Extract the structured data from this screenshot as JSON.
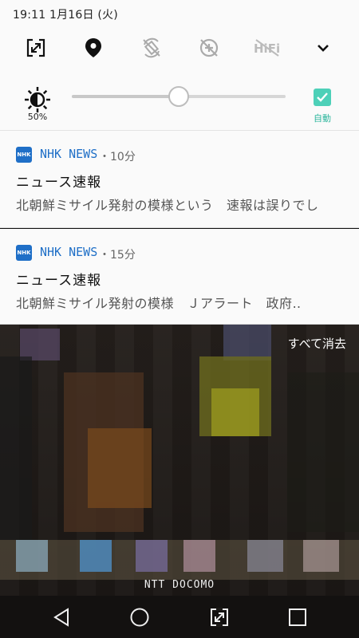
{
  "status_bar": {
    "time_date": "19:11 1月16日 (火)"
  },
  "quick_tiles": [
    {
      "icon": "screen-rotation-icon"
    },
    {
      "icon": "location-icon"
    },
    {
      "icon": "auto-rotate-off-icon"
    },
    {
      "icon": "data-saver-off-icon"
    },
    {
      "icon": "hifi-off-icon"
    },
    {
      "icon": "chevron-down-icon"
    }
  ],
  "brightness": {
    "percent_label": "50%",
    "level": 0.5,
    "auto_label": "自動",
    "auto_checked": true
  },
  "notifications": [
    {
      "app": "NHK NEWS",
      "logo": "NHK",
      "time": "・10分",
      "title": "ニュース速報",
      "body": "北朝鮮ミサイル発射の模様という　速報は誤りでし"
    },
    {
      "app": "NHK NEWS",
      "logo": "NHK",
      "time": "・15分",
      "title": "ニュース速報",
      "body": "北朝鮮ミサイル発射の模様　Ｊアラート　政府‥"
    }
  ],
  "clear_all_label": "すべて消去",
  "carrier": "NTT DOCOMO",
  "colors": {
    "accent_teal": "#4dd0b8",
    "nhk_blue": "#1f6fc7"
  }
}
